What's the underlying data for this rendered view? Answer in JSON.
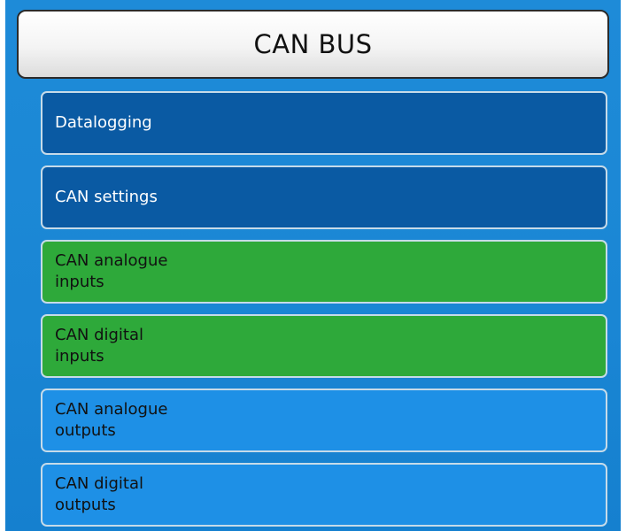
{
  "header": {
    "title": "CAN BUS"
  },
  "menu": {
    "items": [
      {
        "label": "Datalogging",
        "style": "dark-blue"
      },
      {
        "label": "CAN settings",
        "style": "dark-blue"
      },
      {
        "label": "CAN analogue\ninputs",
        "style": "green"
      },
      {
        "label": "CAN digital\ninputs",
        "style": "green"
      },
      {
        "label": "CAN analogue\noutputs",
        "style": "light-blue"
      },
      {
        "label": "CAN digital\noutputs",
        "style": "light-blue"
      }
    ]
  },
  "colors": {
    "background": "#1a86d4",
    "dark_blue_item": "#0a5aa3",
    "green_item": "#2ea93a",
    "light_blue_item": "#1e90e6",
    "title_bar": "#f4f4f4"
  }
}
